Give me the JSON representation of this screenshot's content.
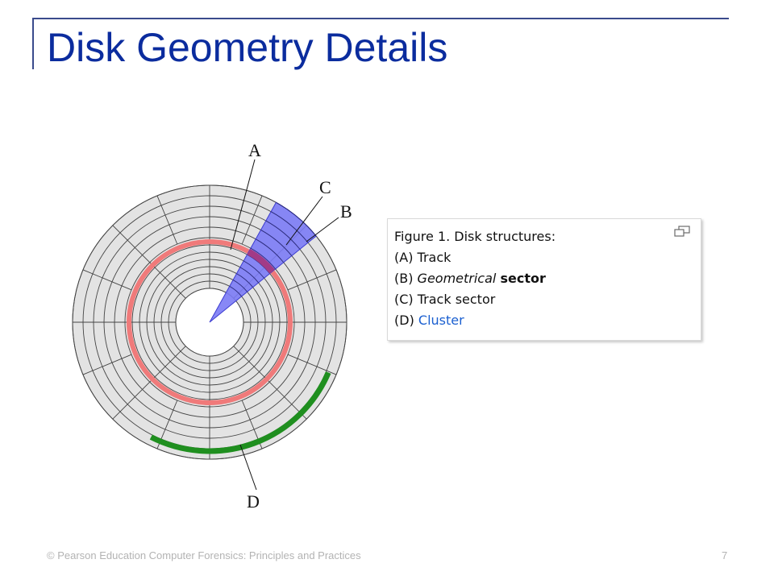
{
  "slide": {
    "title": "Disk Geometry Details",
    "footer": "© Pearson Education  Computer Forensics: Principles and Practices",
    "page_number": "7"
  },
  "diagram": {
    "labels": {
      "a": "A",
      "b": "B",
      "c": "C",
      "d": "D"
    },
    "colors": {
      "platter": "#e3e3e3",
      "grid_lines": "#444444",
      "track_highlight": "#f07a7a",
      "geometric_sector": "#7b7bf5",
      "track_sector": "#a23b86",
      "cluster": "#1f8f1f"
    }
  },
  "caption": {
    "heading": "Figure 1. Disk structures:",
    "a_prefix": "(A) ",
    "a_text": "Track",
    "b_prefix": "(B) ",
    "b_em": "Geometrical",
    "b_strong": "sector",
    "c_prefix": "(C) ",
    "c_text": "Track sector",
    "d_prefix": "(D) ",
    "d_link": "Cluster",
    "icon": "enlarge-icon"
  }
}
